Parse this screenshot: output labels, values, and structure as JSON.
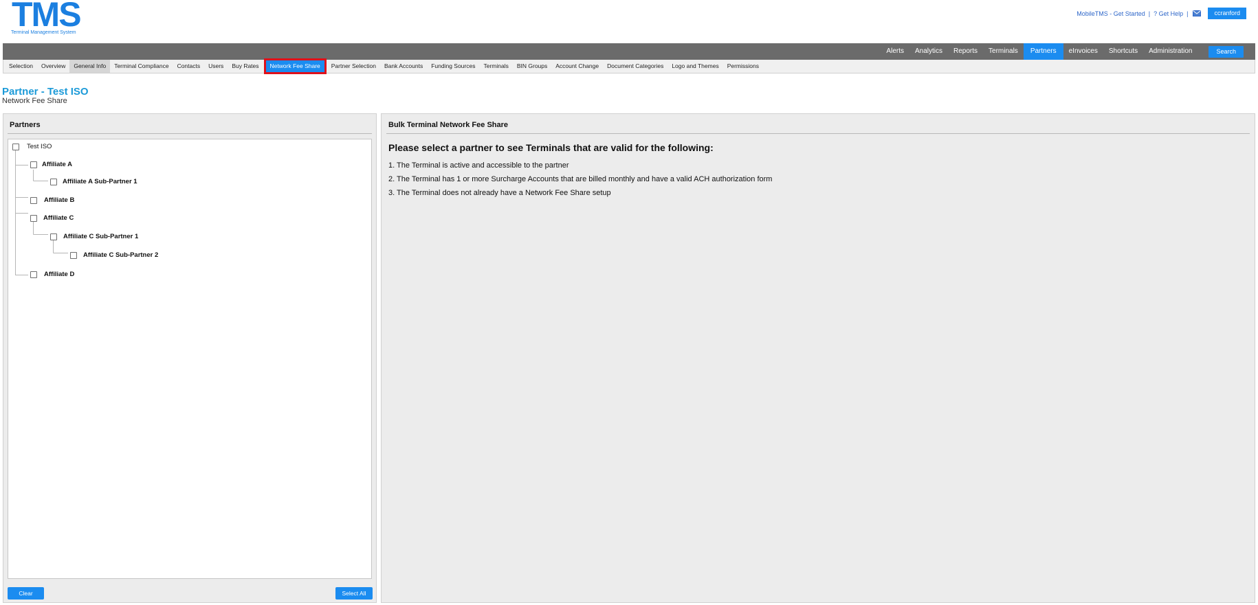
{
  "logo": {
    "main": "TMS",
    "sub": "Terminal Management System"
  },
  "top_links": {
    "get_started": "MobileTMS - Get Started",
    "separator": "|",
    "get_help": "? Get Help",
    "user": "ccranford"
  },
  "main_nav": {
    "items": [
      "Alerts",
      "Analytics",
      "Reports",
      "Terminals",
      "Partners",
      "eInvoices",
      "Shortcuts",
      "Administration"
    ],
    "active": "Partners",
    "search_label": "Search"
  },
  "sub_nav": {
    "items": [
      "Selection",
      "Overview",
      "General Info",
      "Terminal Compliance",
      "Contacts",
      "Users",
      "Buy Rates",
      "Network Fee Share",
      "Partner Selection",
      "Bank Accounts",
      "Funding Sources",
      "Terminals",
      "BIN Groups",
      "Account Change",
      "Document Categories",
      "Logo and Themes",
      "Permissions"
    ],
    "active": "Network Fee Share",
    "hovered": "General Info"
  },
  "page": {
    "title": "Partner - Test ISO",
    "subtitle": "Network Fee Share"
  },
  "partners_panel": {
    "title": "Partners",
    "tree": [
      {
        "label": "Test ISO",
        "level": 0
      },
      {
        "label": "Affiliate A",
        "level": 1
      },
      {
        "label": "Affiliate A Sub-Partner 1",
        "level": 2
      },
      {
        "label": "Affiliate B",
        "level": 1
      },
      {
        "label": "Affiliate C",
        "level": 1
      },
      {
        "label": "Affiliate C Sub-Partner 1",
        "level": 2
      },
      {
        "label": "Affiliate C Sub-Partner 2",
        "level": 3
      },
      {
        "label": "Affiliate D",
        "level": 1
      }
    ],
    "clear_label": "Clear",
    "select_all_label": "Select All"
  },
  "bulk_panel": {
    "title": "Bulk Terminal Network Fee Share",
    "heading": "Please select a partner to see Terminals that are valid for the following:",
    "items": [
      "1. The Terminal is active and accessible to the partner",
      "2. The Terminal has 1 or more Surcharge Accounts that are billed monthly and have a valid ACH authorization form",
      "3. The Terminal does not already have a Network Fee Share setup"
    ]
  },
  "colors": {
    "accent": "#1b8cf0",
    "title_blue": "#1b9ad8",
    "nav_bg": "#6b6b6b",
    "highlight_border": "#e0101a"
  }
}
